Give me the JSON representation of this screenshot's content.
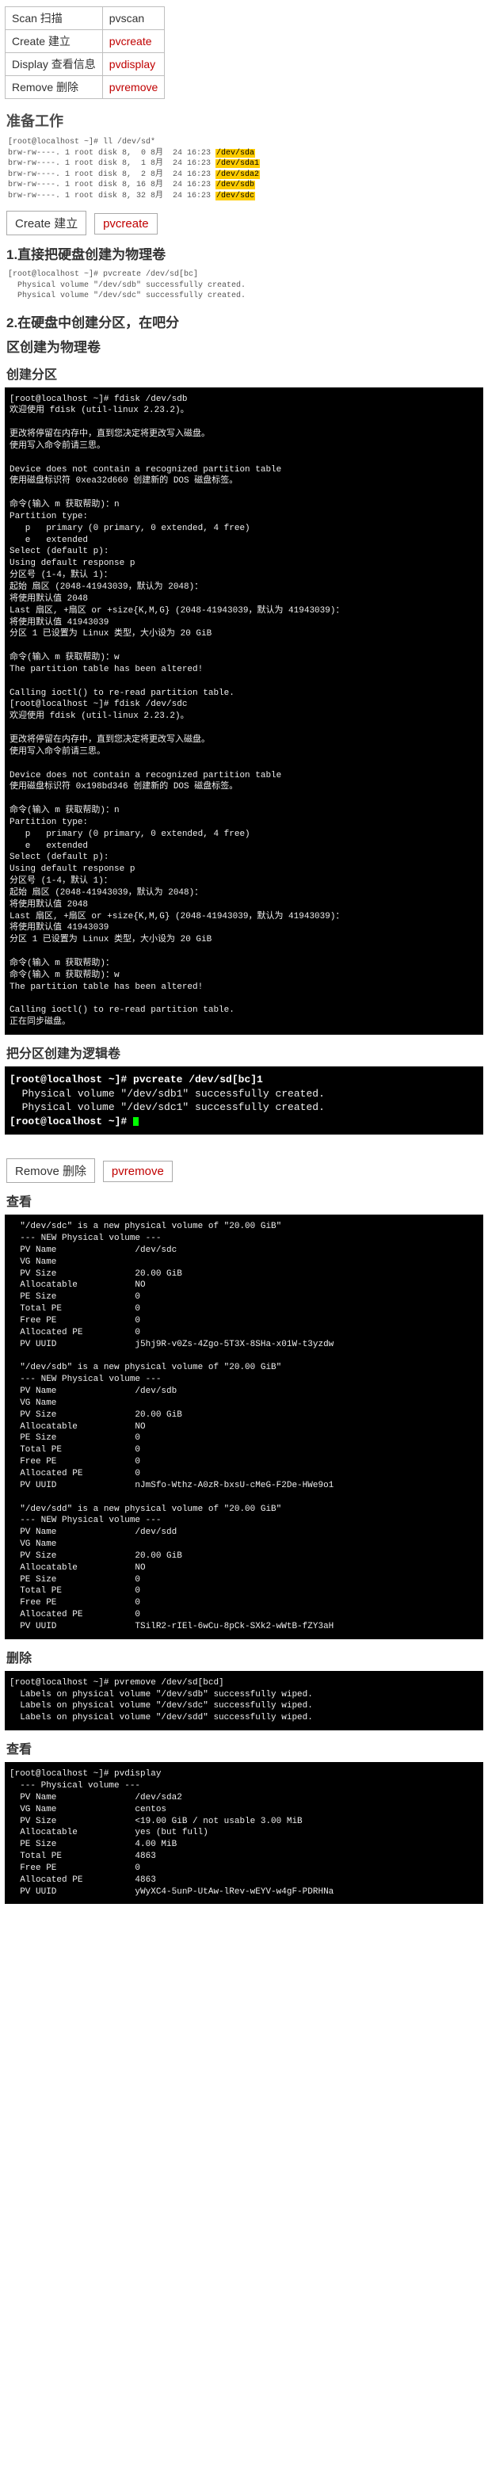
{
  "cmd_table": {
    "rows": [
      {
        "name_cn": "Scan 扫描",
        "cmd": "pvscan",
        "red": false
      },
      {
        "name_cn": "Create 建立",
        "cmd": "pvcreate",
        "red": true
      },
      {
        "name_cn": "Display 查看信息",
        "cmd": "pvdisplay",
        "red": true
      },
      {
        "name_cn": "Remove 删除",
        "cmd": "pvremove",
        "red": true
      }
    ]
  },
  "sec_prep": "准备工作",
  "ll_block": {
    "prompt": "[root@localhost ~]# ll /dev/sd*",
    "lines": [
      "brw-rw----. 1 root disk 8,  0 8月  24 16:23 ",
      "brw-rw----. 1 root disk 8,  1 8月  24 16:23 ",
      "brw-rw----. 1 root disk 8,  2 8月  24 16:23 ",
      "brw-rw----. 1 root disk 8, 16 8月  24 16:23 ",
      "brw-rw----. 1 root disk 8, 32 8月  24 16:23 "
    ],
    "devs": [
      "/dev/sda",
      "/dev/sda1",
      "/dev/sda2",
      "/dev/sdb",
      "/dev/sdc"
    ]
  },
  "create_box": {
    "a": "Create 建立",
    "b": "pvcreate"
  },
  "create_sub1": "1.直接把硬盘创建为物理卷",
  "pvcreate_block": {
    "prompt": "[root@localhost ~]# pvcreate /dev/sd[bc]",
    "l1": "  Physical volume \"/dev/sdb\" successfully created.",
    "l2": "  Physical volume \"/dev/sdc\" successfully created."
  },
  "create_sub2a": "2.在硬盘中创建分区，在吧分",
  "create_sub2b": "区创建为物理卷",
  "create_fdisk_title": "创建分区",
  "fdisk_block": "[root@localhost ~]# fdisk /dev/sdb\n欢迎使用 fdisk (util-linux 2.23.2)。\n\n更改将停留在内存中，直到您决定将更改写入磁盘。\n使用写入命令前请三思。\n\nDevice does not contain a recognized partition table\n使用磁盘标识符 0xea32d660 创建新的 DOS 磁盘标签。\n\n命令(输入 m 获取帮助)：n\nPartition type:\n   p   primary (0 primary, 0 extended, 4 free)\n   e   extended\nSelect (default p):\nUsing default response p\n分区号 (1-4，默认 1)：\n起始 扇区 (2048-41943039，默认为 2048)：\n将使用默认值 2048\nLast 扇区, +扇区 or +size{K,M,G} (2048-41943039，默认为 41943039)：\n将使用默认值 41943039\n分区 1 已设置为 Linux 类型，大小设为 20 GiB\n\n命令(输入 m 获取帮助)：w\nThe partition table has been altered!\n\nCalling ioctl() to re-read partition table.\n[root@localhost ~]# fdisk /dev/sdc\n欢迎使用 fdisk (util-linux 2.23.2)。\n\n更改将停留在内存中，直到您决定将更改写入磁盘。\n使用写入命令前请三思。\n\nDevice does not contain a recognized partition table\n使用磁盘标识符 0x198bd346 创建新的 DOS 磁盘标签。\n\n命令(输入 m 获取帮助)：n\nPartition type:\n   p   primary (0 primary, 0 extended, 4 free)\n   e   extended\nSelect (default p):\nUsing default response p\n分区号 (1-4，默认 1)：\n起始 扇区 (2048-41943039，默认为 2048)：\n将使用默认值 2048\nLast 扇区, +扇区 or +size{K,M,G} (2048-41943039，默认为 41943039)：\n将使用默认值 41943039\n分区 1 已设置为 Linux 类型，大小设为 20 GiB\n\n命令(输入 m 获取帮助)：\n命令(输入 m 获取帮助)：w\nThe partition table has been altered!\n\nCalling ioctl() to re-read partition table.\n正在同步磁盘。",
  "create_lv_title": "把分区创建为逻辑卷",
  "pvcreate2": {
    "prompt": "[root@localhost ~]# pvcreate /dev/sd[bc]1",
    "l1": "  Physical volume \"/dev/sdb1\" successfully created.",
    "l2": "  Physical volume \"/dev/sdc1\" successfully created.",
    "prompt2": "[root@localhost ~]# "
  },
  "remove_box": {
    "a": "Remove 删除",
    "b": "pvremove"
  },
  "view_title": "查看",
  "view_block": "  \"/dev/sdc\" is a new physical volume of \"20.00 GiB\"\n  --- NEW Physical volume ---\n  PV Name               /dev/sdc\n  VG Name               \n  PV Size               20.00 GiB\n  Allocatable           NO\n  PE Size               0   \n  Total PE              0\n  Free PE               0\n  Allocated PE          0\n  PV UUID               j5hj9R-v0Zs-4Zgo-5T3X-8SHa-x01W-t3yzdw\n   \n  \"/dev/sdb\" is a new physical volume of \"20.00 GiB\"\n  --- NEW Physical volume ---\n  PV Name               /dev/sdb\n  VG Name               \n  PV Size               20.00 GiB\n  Allocatable           NO\n  PE Size               0   \n  Total PE              0\n  Free PE               0\n  Allocated PE          0\n  PV UUID               nJmSfo-Wthz-A0zR-bxsU-cMeG-F2De-HWe9o1\n   \n  \"/dev/sdd\" is a new physical volume of \"20.00 GiB\"\n  --- NEW Physical volume ---\n  PV Name               /dev/sdd\n  VG Name               \n  PV Size               20.00 GiB\n  Allocatable           NO\n  PE Size               0   \n  Total PE              0\n  Free PE               0\n  Allocated PE          0\n  PV UUID               TSilR2-rIEl-6wCu-8pCk-SXk2-wWtB-fZY3aH",
  "delete_title": "删除",
  "delete_block": "[root@localhost ~]# pvremove /dev/sd[bcd]\n  Labels on physical volume \"/dev/sdb\" successfully wiped.\n  Labels on physical volume \"/dev/sdc\" successfully wiped.\n  Labels on physical volume \"/dev/sdd\" successfully wiped.",
  "view2_title": "查看",
  "view2_block": "[root@localhost ~]# pvdisplay\n  --- Physical volume ---\n  PV Name               /dev/sda2\n  VG Name               centos\n  PV Size               <19.00 GiB / not usable 3.00 MiB\n  Allocatable           yes (but full)\n  PE Size               4.00 MiB\n  Total PE              4863\n  Free PE               0\n  Allocated PE          4863\n  PV UUID               yWyXC4-5unP-UtAw-lRev-wEYV-w4gF-PDRHNa"
}
